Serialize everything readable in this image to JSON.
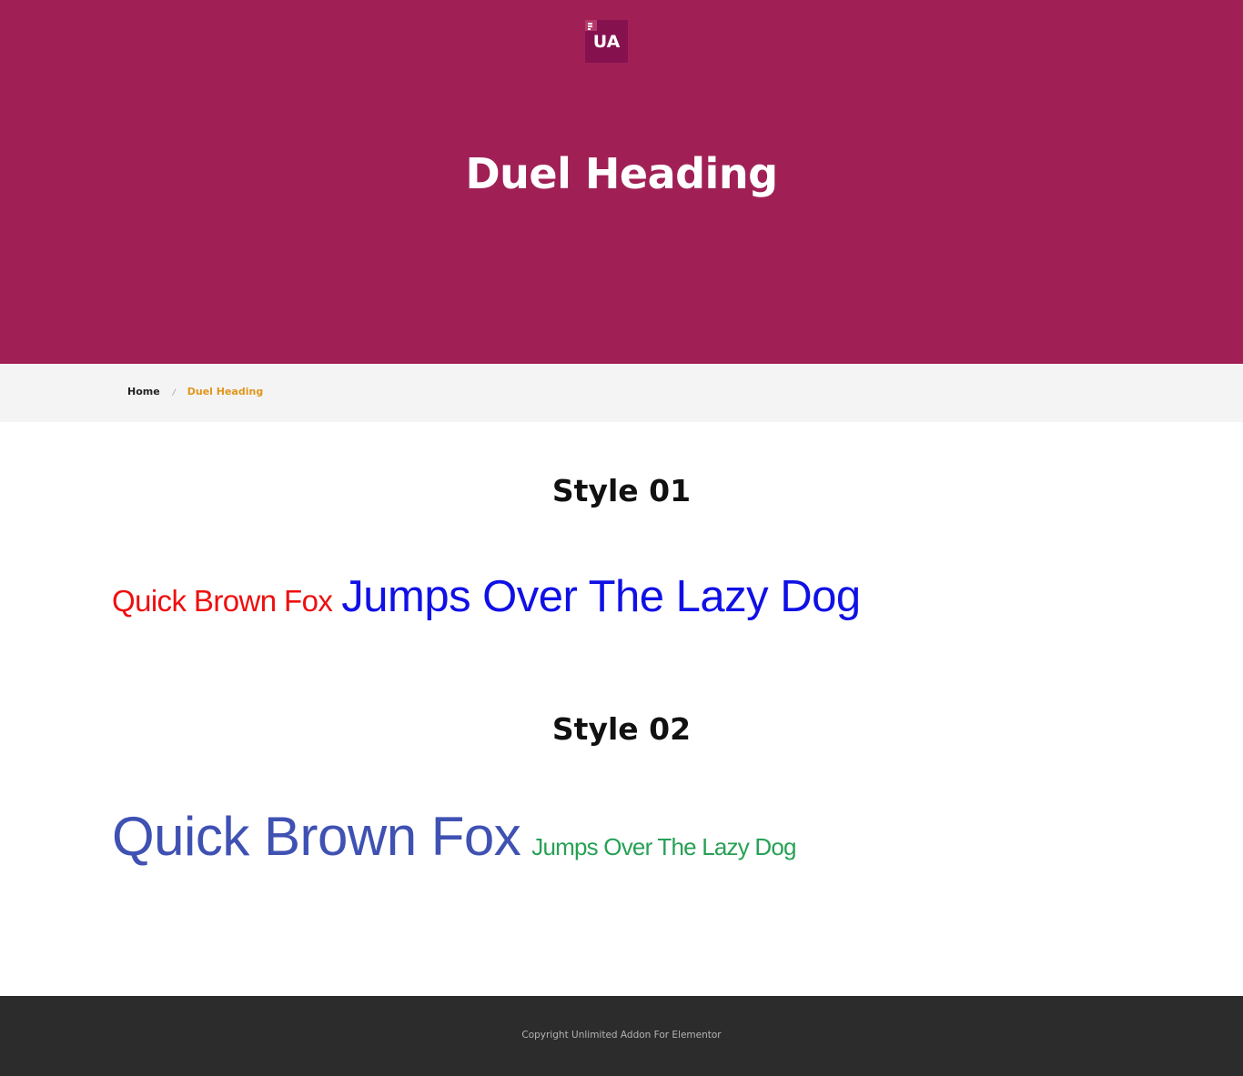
{
  "header": {
    "logo_text": "UA",
    "title": "Duel Heading"
  },
  "breadcrumb": {
    "home": "Home",
    "separator": "/",
    "current": "Duel Heading"
  },
  "styles": [
    {
      "heading": "Style 01",
      "first_text": "Quick Brown Fox",
      "second_text": "Jumps Over The Lazy Dog",
      "first_color": "#ee0f0f",
      "second_color": "#1010e6"
    },
    {
      "heading": "Style 02",
      "first_text": "Quick Brown Fox",
      "second_text": "Jumps Over The Lazy Dog",
      "first_color": "#3f51b2",
      "second_color": "#27a155"
    }
  ],
  "footer": {
    "copyright": "Copyright Unlimited Addon For Elementor"
  },
  "colors": {
    "hero_bg": "#a02056",
    "logo_bg": "#85114f",
    "breadcrumb_bg": "#f4f4f4",
    "breadcrumb_active": "#e0961c",
    "footer_bg": "#2c2c2c"
  }
}
